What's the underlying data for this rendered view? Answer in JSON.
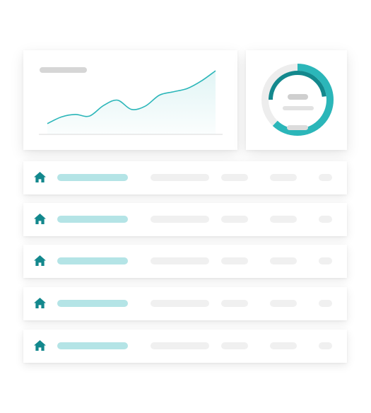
{
  "colors": {
    "accent": "#2bb6b9",
    "accent_dark": "#13888d",
    "label_tint": "#b4e4e6",
    "skeleton": "#ebebeb",
    "track": "#ededed"
  },
  "chart_data": {
    "type": "area",
    "title": "",
    "xlabel": "",
    "ylabel": "",
    "grid": false,
    "x": [
      0,
      1,
      2,
      3,
      4,
      5,
      6,
      7,
      8,
      9,
      10,
      11,
      12
    ],
    "y": [
      2,
      18,
      24,
      20,
      45,
      58,
      36,
      44,
      70,
      78,
      86,
      104,
      128
    ],
    "ylim": [
      0,
      140
    ]
  },
  "gauge": {
    "value_fraction": 0.62,
    "inner_fraction": 0.48
  },
  "table": {
    "icon": "home-icon",
    "rows": [
      {
        "id": "r1"
      },
      {
        "id": "r2"
      },
      {
        "id": "r3"
      },
      {
        "id": "r4"
      },
      {
        "id": "r5"
      }
    ]
  }
}
